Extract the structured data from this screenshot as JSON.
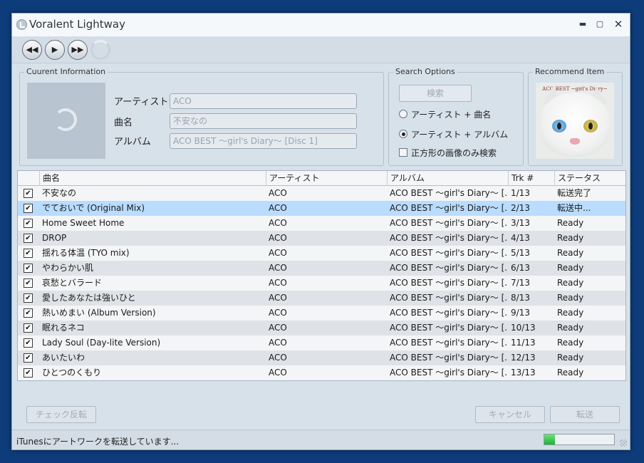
{
  "window": {
    "title": "Voralent Lightway",
    "controls": {
      "minimize": "▬",
      "maximize": "▢",
      "close": "✕"
    }
  },
  "toolbar": {
    "prev_icon": "◀◀",
    "play_icon": "▶",
    "next_icon": "▶▶"
  },
  "current_info": {
    "group_title": "Cuurent Information",
    "artist_label": "アーティスト",
    "artist_value": "ACO",
    "title_label": "曲名",
    "title_value": "不安なの",
    "album_label": "アルバム",
    "album_value": "ACO  BEST ～girl's Diary～ [Disc 1]"
  },
  "search_options": {
    "group_title": "Search Options",
    "search_button": "検索",
    "option_artist_title": "アーティスト + 曲名",
    "option_artist_album": "アーティスト + アルバム",
    "selected_option": "artist_album",
    "square_only_label": "正方形の画像のみ検索",
    "square_only_checked": false
  },
  "recommend": {
    "group_title": "Recommend Item",
    "cover_text": "ACO BEST ~girl's Diary~"
  },
  "table": {
    "headers": {
      "title": "曲名",
      "artist": "アーティスト",
      "album": "アルバム",
      "track": "Trk #",
      "status": "ステータス"
    },
    "check_mark": "✔",
    "rows": [
      {
        "checked": true,
        "title": "不安なの",
        "artist": "ACO",
        "album": "ACO BEST ～girl's Diary～ [...",
        "track": "1/13",
        "status": "転送完了"
      },
      {
        "checked": true,
        "title": "でておいで (Original Mix)",
        "artist": "ACO",
        "album": "ACO BEST ～girl's Diary～ [...",
        "track": "2/13",
        "status": "転送中..."
      },
      {
        "checked": true,
        "title": "Home Sweet Home",
        "artist": "ACO",
        "album": "ACO BEST ～girl's Diary～ [...",
        "track": "3/13",
        "status": "Ready"
      },
      {
        "checked": true,
        "title": "DROP",
        "artist": "ACO",
        "album": "ACO BEST ～girl's Diary～ [...",
        "track": "4/13",
        "status": "Ready"
      },
      {
        "checked": true,
        "title": "揺れる体温 (TYO mix)",
        "artist": "ACO",
        "album": "ACO BEST ～girl's Diary～ [...",
        "track": "5/13",
        "status": "Ready"
      },
      {
        "checked": true,
        "title": "やわらかい肌",
        "artist": "ACO",
        "album": "ACO BEST ～girl's Diary～ [...",
        "track": "6/13",
        "status": "Ready"
      },
      {
        "checked": true,
        "title": "哀愁とバラード",
        "artist": "ACO",
        "album": "ACO BEST ～girl's Diary～ [...",
        "track": "7/13",
        "status": "Ready"
      },
      {
        "checked": true,
        "title": "愛したあなたは強いひと",
        "artist": "ACO",
        "album": "ACO BEST ～girl's Diary～ [...",
        "track": "8/13",
        "status": "Ready"
      },
      {
        "checked": true,
        "title": "熱いめまい (Album Version)",
        "artist": "ACO",
        "album": "ACO BEST ～girl's Diary～ [...",
        "track": "9/13",
        "status": "Ready"
      },
      {
        "checked": true,
        "title": "眠れるネコ",
        "artist": "ACO",
        "album": "ACO BEST ～girl's Diary～ [...",
        "track": "10/13",
        "status": "Ready"
      },
      {
        "checked": true,
        "title": "Lady Soul (Day-lite Version)",
        "artist": "ACO",
        "album": "ACO BEST ～girl's Diary～ [...",
        "track": "11/13",
        "status": "Ready"
      },
      {
        "checked": true,
        "title": "あいたいわ",
        "artist": "ACO",
        "album": "ACO BEST ～girl's Diary～ [...",
        "track": "12/13",
        "status": "Ready"
      },
      {
        "checked": true,
        "title": "ひとつのくもり",
        "artist": "ACO",
        "album": "ACO BEST ～girl's Diary～ [...",
        "track": "13/13",
        "status": "Ready"
      }
    ]
  },
  "footer": {
    "invert_check": "チェック反転",
    "cancel": "キャンセル",
    "transfer": "転送"
  },
  "status": {
    "message": "iTunesにアートワークを転送しています...",
    "progress": 0.15
  },
  "colors": {
    "desktop": "#0e3c7a",
    "selected_row": "#b9dcff",
    "progress_fill": "#1cb233"
  }
}
